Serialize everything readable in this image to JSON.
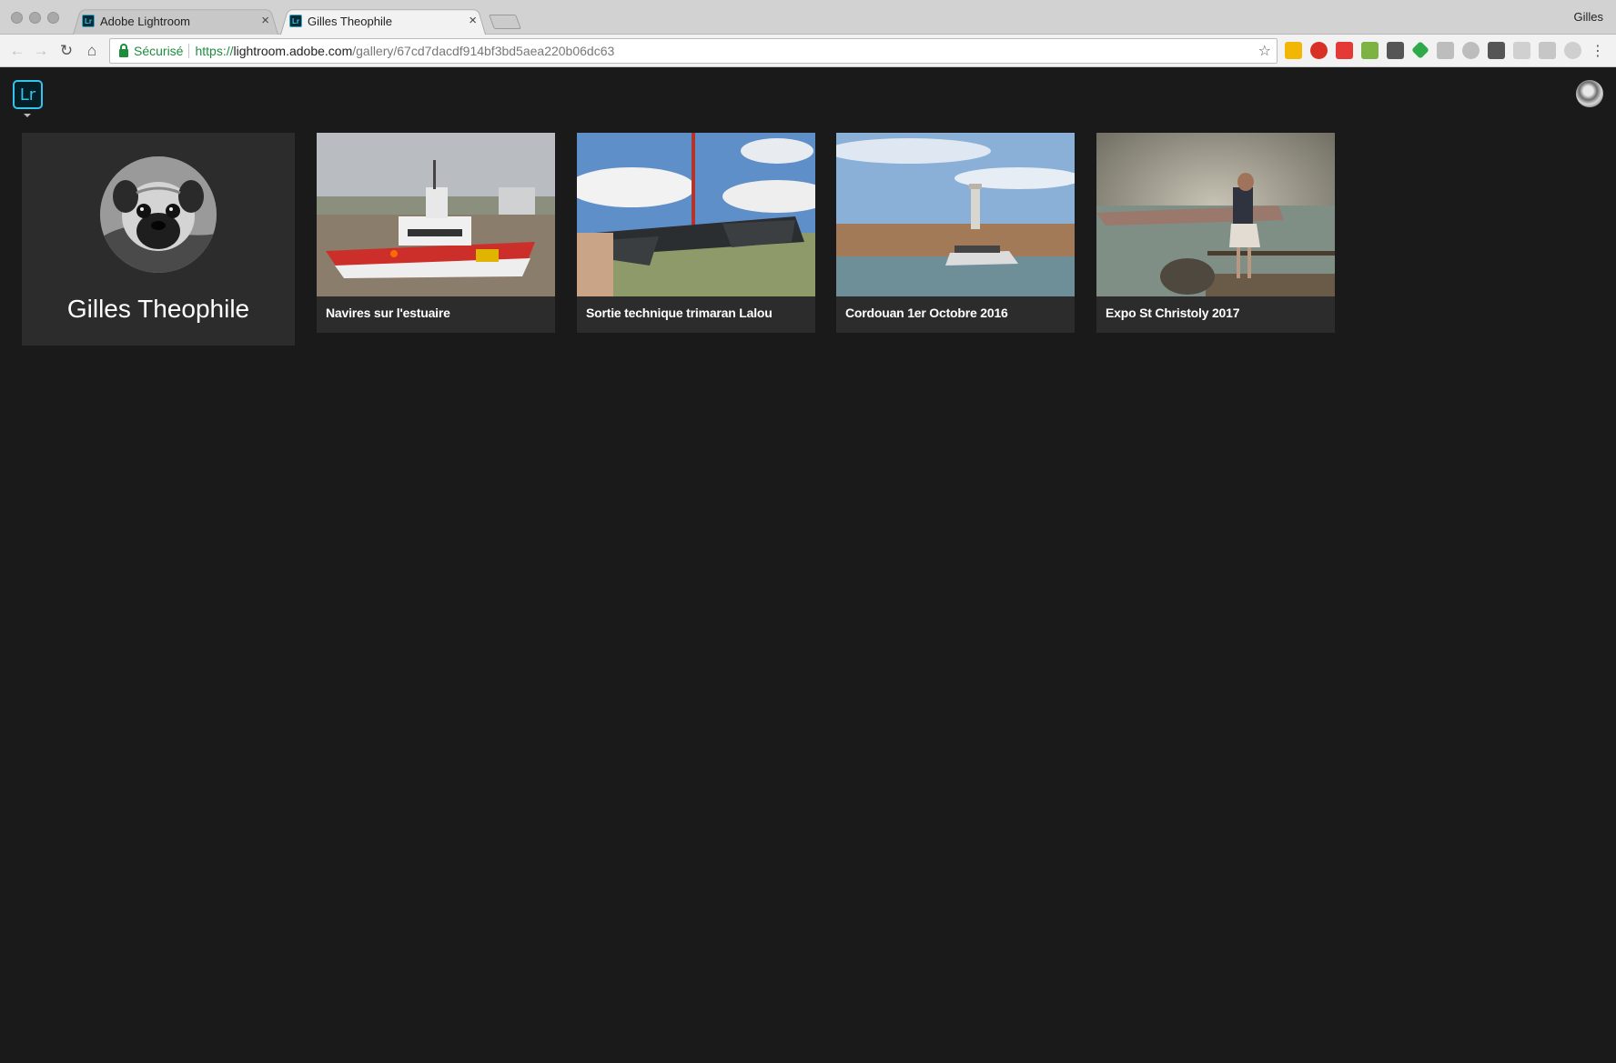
{
  "browser": {
    "tabs": [
      {
        "label": "Adobe Lightroom",
        "favicon": "Lr",
        "active": false
      },
      {
        "label": "Gilles Theophile",
        "favicon": "Lr",
        "active": true
      }
    ],
    "profile_name": "Gilles",
    "secure_label": "Sécurisé",
    "url": {
      "scheme": "https://",
      "host": "lightroom.adobe.com",
      "path": "/gallery/67cd7dacdf914bf3bd5aea220b06dc63"
    }
  },
  "app": {
    "logo_text": "Lr"
  },
  "profile": {
    "name": "Gilles Theophile"
  },
  "albums": [
    {
      "title": "Navires sur l'estuaire"
    },
    {
      "title": "Sortie technique trimaran Lalou"
    },
    {
      "title": "Cordouan 1er Octobre 2016"
    },
    {
      "title": "Expo St Christoly 2017"
    }
  ],
  "colors": {
    "background": "#1a1a1a",
    "card": "#2c2c2c",
    "lr_accent": "#31c5f0",
    "secure_green": "#1e8e3e"
  }
}
